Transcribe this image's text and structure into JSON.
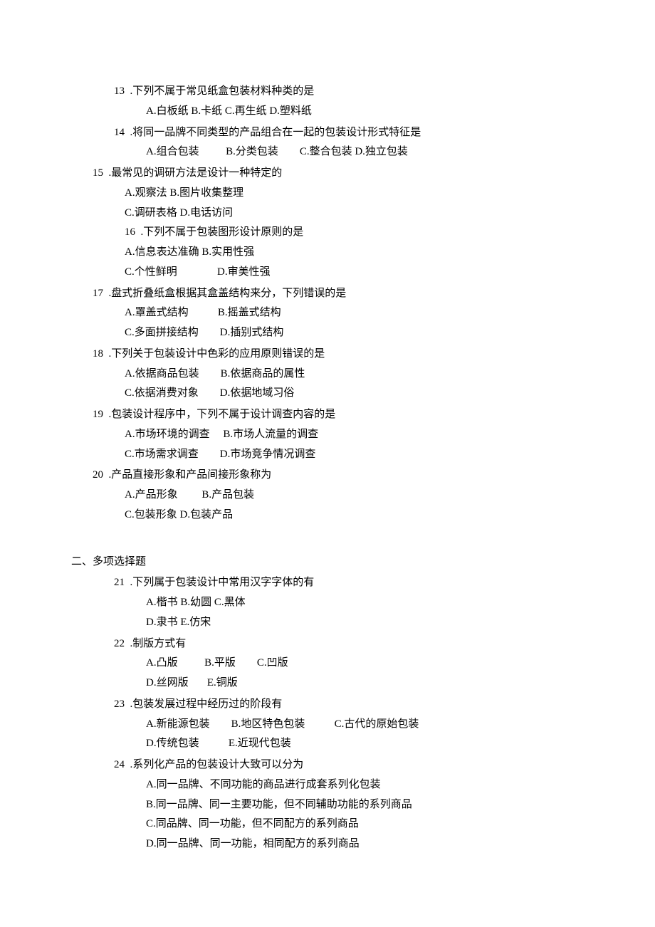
{
  "questions": [
    {
      "num": "13",
      "text": ".下列不属于常见纸盒包装材料种类的是",
      "lines": [
        "A.白板纸 B.卡纸 C.再生纸 D.塑料纸"
      ]
    },
    {
      "num": "14",
      "text": ".将同一品牌不同类型的产品组合在一起的包装设计形式特征是",
      "lines": [
        "A.组合包装          B.分类包装        C.整合包装 D.独立包装"
      ]
    },
    {
      "num": "15",
      "text": ".最常见的调研方法是设计一种特定的",
      "lines": [
        "A.观察法 B.图片收集整理",
        "C.调研表格 D.电话访问",
        "16  .下列不属于包装图形设计原则的是",
        "A.信息表达准确 B.实用性强",
        "C.个性鲜明               D.审美性强"
      ]
    },
    {
      "num": "17",
      "text": ".盘式折叠纸盒根据其盒盖结构来分，下列错误的是",
      "lines": [
        "A.罩盖式结构           B.摇盖式结构",
        "C.多面拼接结构        D.插别式结构"
      ]
    },
    {
      "num": "18",
      "text": ".下列关于包装设计中色彩的应用原则错误的是",
      "lines": [
        "A.依据商品包装        B.依据商品的属性",
        "C.依据消费对象        D.依据地域习俗"
      ]
    },
    {
      "num": "19",
      "text": ".包装设计程序中，下列不属于设计调查内容的是",
      "lines": [
        "A.市场环境的调查     B.市场人流量的调查",
        "C.市场需求调查        D.市场竞争情况调查"
      ]
    },
    {
      "num": "20",
      "text": ".产品直接形象和产品间接形象称为",
      "lines": [
        "A.产品形象         B.产品包装",
        "C.包装形象 D.包装产品"
      ]
    }
  ],
  "section2_title": "二、多项选择题",
  "questions2": [
    {
      "num": "21",
      "text": ".下列属于包装设计中常用汉字字体的有",
      "lines": [
        "A.楷书 B.幼圆 C.黑体",
        "D.隶书 E.仿宋"
      ]
    },
    {
      "num": "22",
      "text": ".制版方式有",
      "lines": [
        "A.凸版          B.平版        C.凹版",
        "D.丝网版       E.铜版"
      ]
    },
    {
      "num": "23",
      "text": ".包装发展过程中经历过的阶段有",
      "lines": [
        "A.新能源包装        B.地区特色包装           C.古代的原始包装",
        "D.传统包装           E.近现代包装"
      ]
    },
    {
      "num": "24",
      "text": ".系列化产品的包装设计大致可以分为",
      "lines": [
        "A.同一品牌、不同功能的商品进行成套系列化包装",
        "B.同一品牌、同一主要功能，但不同辅助功能的系列商品",
        "C.同品牌、同一功能，但不同配方的系列商品",
        "D.同一品牌、同一功能，相同配方的系列商品"
      ]
    }
  ]
}
